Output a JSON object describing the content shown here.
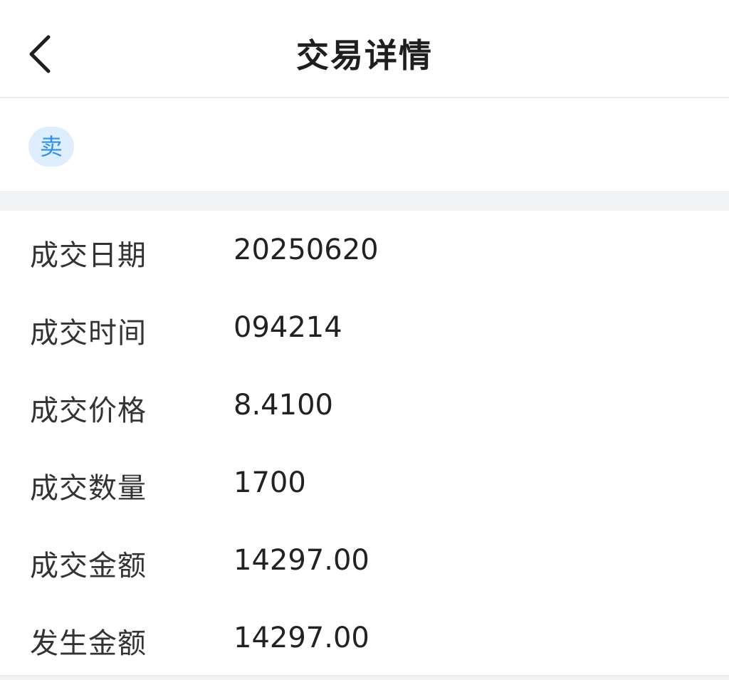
{
  "header": {
    "back_icon": "chevron-left-icon",
    "title": "交易详情"
  },
  "trade_type": {
    "label": "卖",
    "color": "#2f8ff0",
    "background": "#ddeefe"
  },
  "details": {
    "rows": [
      {
        "label": "成交日期",
        "value": "20250620"
      },
      {
        "label": "成交时间",
        "value": "094214"
      },
      {
        "label": "成交价格",
        "value": "8.4100"
      },
      {
        "label": "成交数量",
        "value": "1700"
      },
      {
        "label": "成交金额",
        "value": "14297.00"
      },
      {
        "label": "发生金额",
        "value": "14297.00"
      }
    ]
  }
}
